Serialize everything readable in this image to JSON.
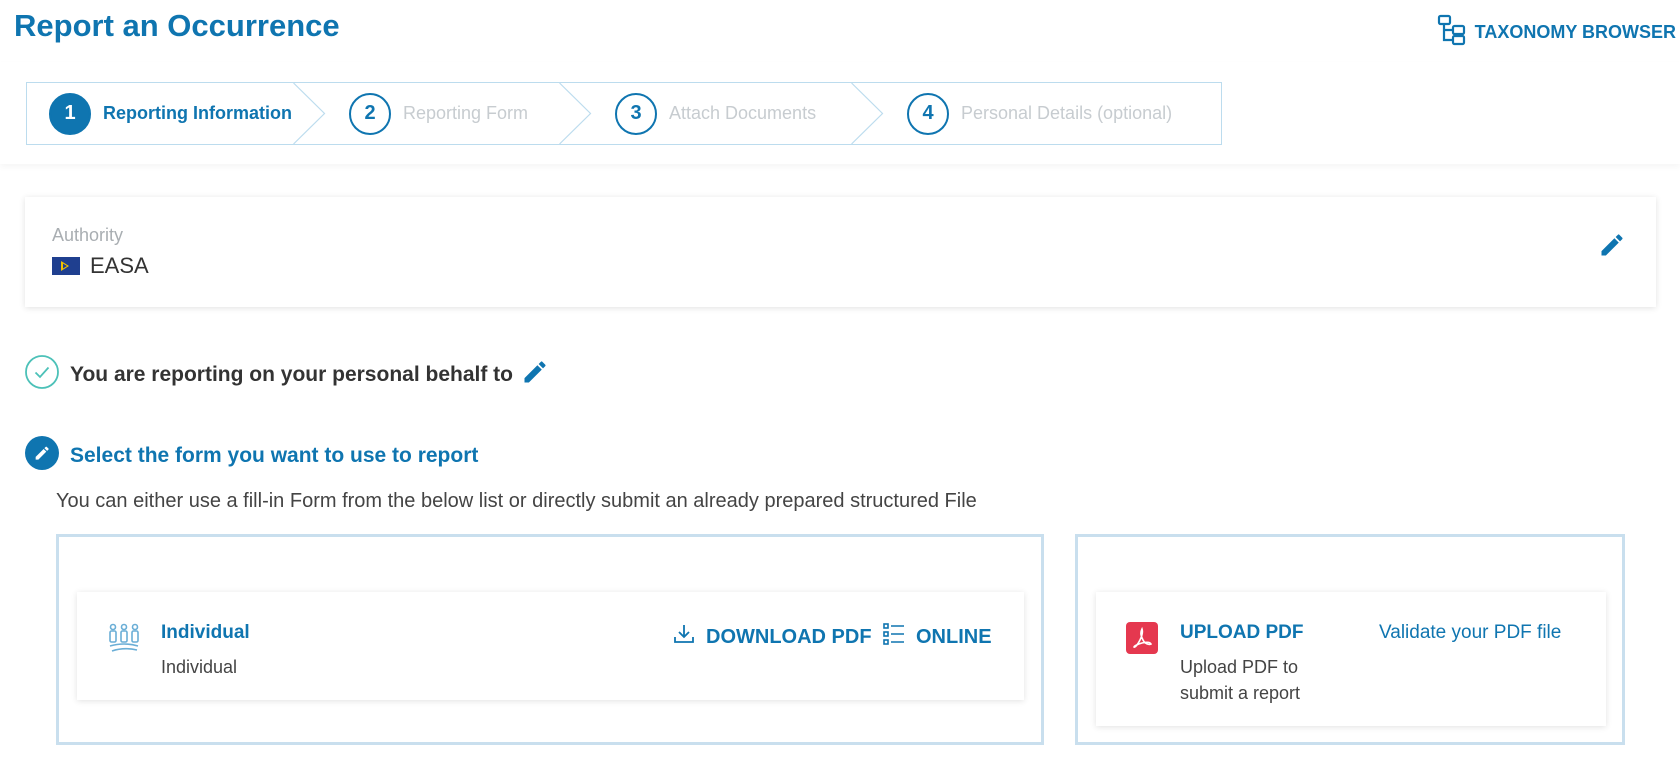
{
  "header": {
    "title": "Report an Occurrence",
    "taxonomy_label": "TAXONOMY BROWSER"
  },
  "steps": [
    {
      "number": "1",
      "label": "Reporting Information",
      "active": true
    },
    {
      "number": "2",
      "label": "Reporting Form",
      "active": false
    },
    {
      "number": "3",
      "label": "Attach Documents",
      "active": false
    },
    {
      "number": "4",
      "label": "Personal Details (optional)",
      "active": false
    }
  ],
  "authority": {
    "label": "Authority",
    "value": "EASA"
  },
  "behalf": {
    "text": "You are reporting on your personal behalf to"
  },
  "select_form": {
    "heading": "Select the form you want to use to report",
    "description": "You can either use a fill-in Form from the below list or directly submit an already prepared structured File"
  },
  "forms": {
    "individual": {
      "title": "Individual",
      "subtitle": "Individual",
      "download_label": "DOWNLOAD PDF",
      "online_label": "ONLINE"
    },
    "upload": {
      "title": "UPLOAD PDF",
      "subtitle": "Upload PDF to submit a report",
      "validate_label": "Validate your PDF file"
    }
  },
  "colors": {
    "accent": "#0f75b0",
    "muted_step": "#c7ccd0",
    "pdf_red": "#e5384f",
    "check_teal": "#4cc1b8"
  }
}
